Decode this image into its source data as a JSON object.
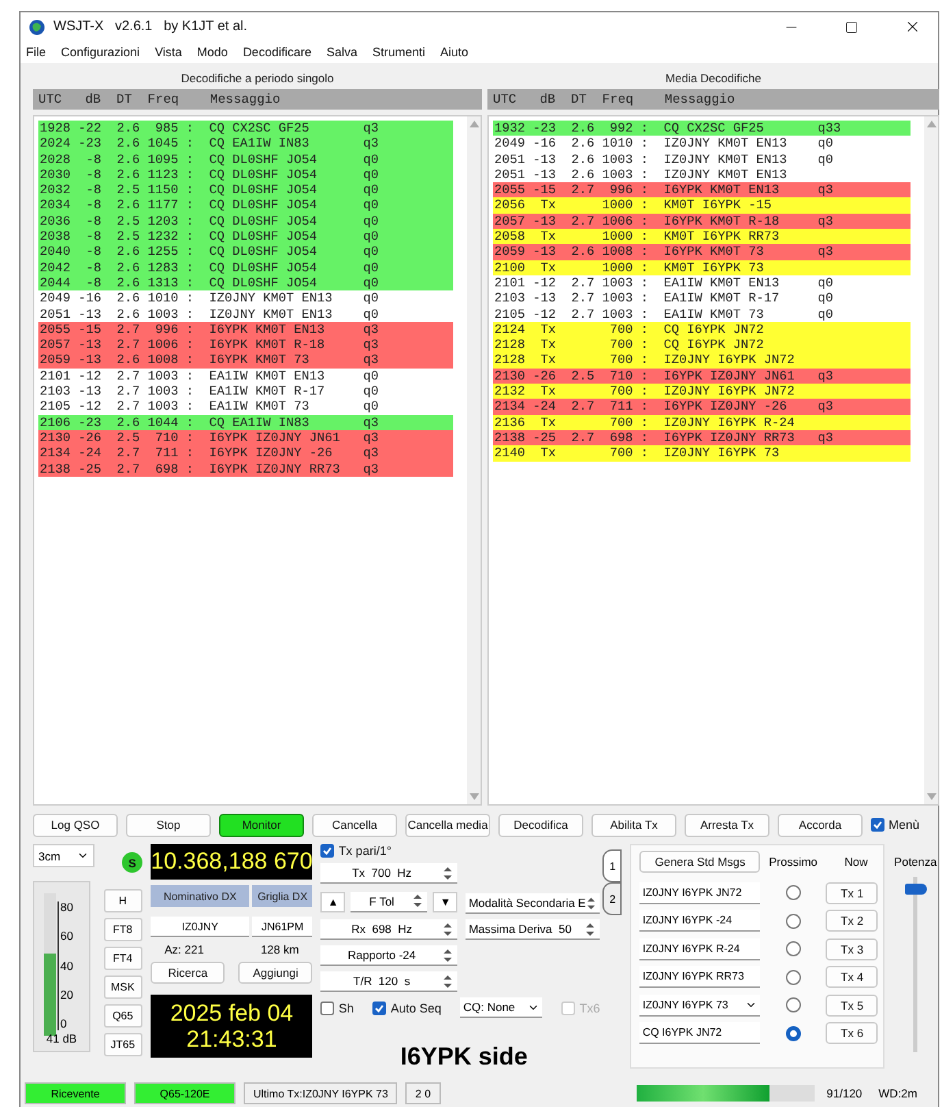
{
  "window": {
    "title": "WSJT-X   v2.6.1   by K1JT et al."
  },
  "menu": [
    "File",
    "Configurazioni",
    "Vista",
    "Modo",
    "Decodificare",
    "Salva",
    "Strumenti",
    "Aiuto"
  ],
  "panels": [
    {
      "title": "Decodifiche a periodo singolo",
      "columns": [
        "UTC",
        "dB",
        "DT",
        "Freq",
        "Messaggio"
      ],
      "rows": [
        {
          "text": "1928 -22  2.6  985 :  CQ CX2SC GF25       q3",
          "kind": "cq"
        },
        {
          "text": "2024 -23  2.6 1045 :  CQ EA1IW IN83       q3",
          "kind": "cq"
        },
        {
          "text": "2028  -8  2.6 1095 :  CQ DL0SHF JO54      q0",
          "kind": "cq"
        },
        {
          "text": "2030  -8  2.6 1123 :  CQ DL0SHF JO54      q0",
          "kind": "cq"
        },
        {
          "text": "2032  -8  2.5 1150 :  CQ DL0SHF JO54      q0",
          "kind": "cq"
        },
        {
          "text": "2034  -8  2.6 1177 :  CQ DL0SHF JO54      q0",
          "kind": "cq"
        },
        {
          "text": "2036  -8  2.5 1203 :  CQ DL0SHF JO54      q0",
          "kind": "cq"
        },
        {
          "text": "2038  -8  2.5 1232 :  CQ DL0SHF JO54      q0",
          "kind": "cq"
        },
        {
          "text": "2040  -8  2.6 1255 :  CQ DL0SHF JO54      q0",
          "kind": "cq"
        },
        {
          "text": "2042  -8  2.6 1283 :  CQ DL0SHF JO54      q0",
          "kind": "cq"
        },
        {
          "text": "2044  -8  2.6 1313 :  CQ DL0SHF JO54      q0",
          "kind": "cq"
        },
        {
          "text": "2049 -16  2.6 1010 :  IZ0JNY KM0T EN13    q0",
          "kind": "plain"
        },
        {
          "text": "2051 -13  2.6 1003 :  IZ0JNY KM0T EN13    q0",
          "kind": "plain"
        },
        {
          "text": "2055 -15  2.7  996 :  I6YPK KM0T EN13     q3",
          "kind": "mine"
        },
        {
          "text": "2057 -13  2.7 1006 :  I6YPK KM0T R-18     q3",
          "kind": "mine"
        },
        {
          "text": "2059 -13  2.6 1008 :  I6YPK KM0T 73       q3",
          "kind": "mine"
        },
        {
          "text": "2101 -12  2.7 1003 :  EA1IW KM0T EN13     q0",
          "kind": "plain"
        },
        {
          "text": "2103 -13  2.7 1003 :  EA1IW KM0T R-17     q0",
          "kind": "plain"
        },
        {
          "text": "2105 -12  2.7 1003 :  EA1IW KM0T 73       q0",
          "kind": "plain"
        },
        {
          "text": "2106 -23  2.6 1044 :  CQ EA1IW IN83       q3",
          "kind": "cq"
        },
        {
          "text": "2130 -26  2.5  710 :  I6YPK IZ0JNY JN61   q3",
          "kind": "mine"
        },
        {
          "text": "2134 -24  2.7  711 :  I6YPK IZ0JNY -26    q3",
          "kind": "mine"
        },
        {
          "text": "2138 -25  2.7  698 :  I6YPK IZ0JNY RR73   q3",
          "kind": "mine"
        }
      ]
    },
    {
      "title": "Media Decodifiche",
      "columns": [
        "UTC",
        "dB",
        "DT",
        "Freq",
        "Messaggio"
      ],
      "rows": [
        {
          "text": "1932 -23  2.6  992 :  CQ CX2SC GF25       q33",
          "kind": "cq"
        },
        {
          "text": "2049 -16  2.6 1010 :  IZ0JNY KM0T EN13    q0",
          "kind": "plain"
        },
        {
          "text": "2051 -13  2.6 1003 :  IZ0JNY KM0T EN13    q0",
          "kind": "plain"
        },
        {
          "text": "2051 -13  2.6 1003 :  IZ0JNY KM0T EN13",
          "kind": "plain"
        },
        {
          "text": "2055 -15  2.7  996 :  I6YPK KM0T EN13     q3",
          "kind": "mine"
        },
        {
          "text": "2056  Tx      1000 :  KM0T I6YPK -15",
          "kind": "tx"
        },
        {
          "text": "2057 -13  2.7 1006 :  I6YPK KM0T R-18     q3",
          "kind": "mine"
        },
        {
          "text": "2058  Tx      1000 :  KM0T I6YPK RR73",
          "kind": "tx"
        },
        {
          "text": "2059 -13  2.6 1008 :  I6YPK KM0T 73       q3",
          "kind": "mine"
        },
        {
          "text": "2100  Tx      1000 :  KM0T I6YPK 73",
          "kind": "tx"
        },
        {
          "text": "2101 -12  2.7 1003 :  EA1IW KM0T EN13     q0",
          "kind": "plain"
        },
        {
          "text": "2103 -13  2.7 1003 :  EA1IW KM0T R-17     q0",
          "kind": "plain"
        },
        {
          "text": "2105 -12  2.7 1003 :  EA1IW KM0T 73       q0",
          "kind": "plain"
        },
        {
          "text": "2124  Tx       700 :  CQ I6YPK JN72",
          "kind": "tx"
        },
        {
          "text": "2128  Tx       700 :  CQ I6YPK JN72",
          "kind": "tx"
        },
        {
          "text": "2128  Tx       700 :  IZ0JNY I6YPK JN72",
          "kind": "tx"
        },
        {
          "text": "2130 -26  2.5  710 :  I6YPK IZ0JNY JN61   q3",
          "kind": "mine"
        },
        {
          "text": "2132  Tx       700 :  IZ0JNY I6YPK JN72",
          "kind": "tx"
        },
        {
          "text": "2134 -24  2.7  711 :  I6YPK IZ0JNY -26    q3",
          "kind": "mine"
        },
        {
          "text": "2136  Tx       700 :  IZ0JNY I6YPK R-24",
          "kind": "tx"
        },
        {
          "text": "2138 -25  2.7  698 :  I6YPK IZ0JNY RR73   q3",
          "kind": "mine"
        },
        {
          "text": "2140  Tx       700 :  IZ0JNY I6YPK 73",
          "kind": "tx"
        }
      ]
    }
  ],
  "buttons": [
    {
      "label": "Log QSO",
      "active": false
    },
    {
      "label": "Stop",
      "active": false
    },
    {
      "label": "Monitor",
      "active": true
    },
    {
      "label": "Cancella",
      "active": false
    },
    {
      "label": "Cancella media",
      "active": false
    },
    {
      "label": "Decodifica",
      "active": false
    },
    {
      "label": "Abilita Tx",
      "active": false
    },
    {
      "label": "Arresta Tx",
      "active": false
    },
    {
      "label": "Accorda",
      "active": false
    }
  ],
  "menu_toggle": {
    "label": "Menù",
    "checked": true
  },
  "band": {
    "value": "3cm"
  },
  "s_indicator": "S",
  "meter": {
    "ticks": [
      "80",
      "60",
      "40",
      "20",
      "0"
    ],
    "level": 0.58,
    "reading": "41 dB"
  },
  "mode_buttons": [
    "H",
    "FT8",
    "FT4",
    "MSK",
    "Q65",
    "JT65"
  ],
  "frequency": "10.368,188 670",
  "dx": {
    "call_label": "Nominativo DX",
    "grid_label": "Griglia DX",
    "call": "IZ0JNY",
    "grid": "JN61PM",
    "azimuth": "Az: 221",
    "distance": "128 km"
  },
  "lookup_buttons": [
    "Ricerca",
    "Aggiungi"
  ],
  "clock": {
    "date": "2025 feb 04",
    "time": "21:43:31"
  },
  "tx_even": {
    "label": "Tx pari/1°",
    "checked": true
  },
  "tx_freq": "Tx  700  Hz",
  "ftol": {
    "up": "▲",
    "label": "F Tol",
    "down": "▼"
  },
  "rx_freq": "Rx  698  Hz",
  "report": "Rapporto -24",
  "tr_period": "T/R  120  s",
  "secondary_mode": "Modalità Secondaria E",
  "max_drift": "Massima Deriva  50",
  "options": [
    {
      "label": "Sh",
      "checked": false
    },
    {
      "label": "Auto Seq",
      "checked": true
    }
  ],
  "cq": {
    "value": "CQ: None"
  },
  "tx6": {
    "label": "Tx6",
    "checked": false,
    "disabled": true
  },
  "annotation": "I6YPK side",
  "msg_tabs": [
    {
      "label": "1",
      "selected": true
    },
    {
      "label": "2",
      "selected": false
    }
  ],
  "messages": {
    "generate": "Genera Std Msgs",
    "next_label": "Prossimo",
    "now_label": "Now",
    "rows": [
      {
        "text": "IZ0JNY I6YPK JN72",
        "kind": "field",
        "selected": false,
        "button": "Tx 1"
      },
      {
        "text": "IZ0JNY I6YPK -24",
        "kind": "field",
        "selected": false,
        "button": "Tx 2"
      },
      {
        "text": "IZ0JNY I6YPK R-24",
        "kind": "field",
        "selected": false,
        "button": "Tx 3"
      },
      {
        "text": "IZ0JNY I6YPK RR73",
        "kind": "field",
        "selected": false,
        "button": "Tx 4"
      },
      {
        "text": "IZ0JNY I6YPK 73",
        "kind": "dropdown",
        "selected": false,
        "button": "Tx 5"
      },
      {
        "text": "CQ I6YPK JN72",
        "kind": "field",
        "selected": true,
        "button": "Tx 6"
      }
    ]
  },
  "power": {
    "label": "Potenza",
    "level": 0.96
  },
  "status_bar": {
    "items": [
      {
        "text": "Ricevente",
        "kind": "green"
      },
      {
        "text": "Q65-120E",
        "kind": "green"
      },
      {
        "text": "Ultimo Tx:IZ0JNY I6YPK 73",
        "kind": "plain"
      },
      {
        "text": "2 0",
        "kind": "plain"
      }
    ],
    "progress": {
      "level": 0.75,
      "reading": "91/120"
    },
    "watchdog": "WD:2m"
  }
}
